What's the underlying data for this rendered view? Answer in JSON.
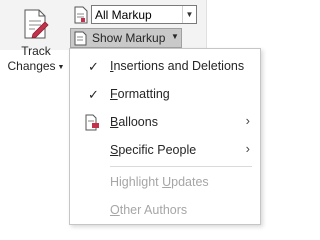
{
  "ribbon": {
    "track_changes": {
      "line1": "Track",
      "line2": "Changes",
      "caret": "⌄"
    },
    "markup_combo": {
      "value": "All Markup",
      "arrow": "⌄"
    },
    "show_markup": {
      "label": "Show Markup",
      "arrow": "⌄"
    }
  },
  "menu": {
    "items": [
      {
        "label": "Insertions and Deletions",
        "underline": "I",
        "checked": true
      },
      {
        "label": "Formatting",
        "underline": "F",
        "checked": true
      },
      {
        "label": "Balloons",
        "underline": "B",
        "submenu": true
      },
      {
        "label": "Specific People",
        "underline": "S",
        "submenu": true
      },
      {
        "label": "Highlight Updates",
        "underline": "U",
        "disabled": true
      },
      {
        "label": "Other Authors",
        "underline": "O",
        "disabled": true
      }
    ],
    "check_glyph": "✓",
    "submenu_glyph": "›"
  },
  "colors": {
    "accent_red": "#c4314b",
    "disabled": "#a6a6a6",
    "selected_button": "#c9c9c9"
  }
}
